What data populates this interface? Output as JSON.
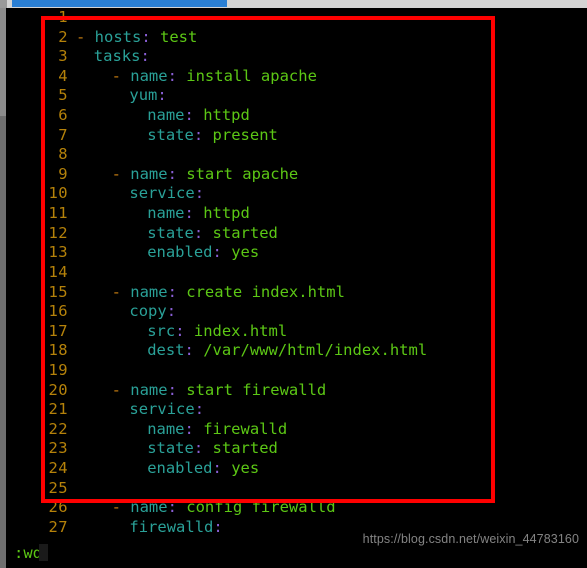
{
  "app": {
    "type": "terminal-text-editor",
    "editor": "vim",
    "language": "yaml"
  },
  "topbar": {
    "progress_visible": true,
    "progress_color": "#2a7fd4",
    "track_color": "#d4d4d4"
  },
  "colors": {
    "background": "#000000",
    "line_number": "#b5820a",
    "key": "#2aa198",
    "colon": "#8a5fd6",
    "value": "#5cc715",
    "dash": "#c07a10",
    "doc_start": "#9b6fd1",
    "annotation_box": "#ff0000",
    "status_text": "#5cc715"
  },
  "annotation": {
    "shape": "rectangle",
    "color": "#ff0000",
    "covers_lines": "1-24",
    "label": "red-highlight-box"
  },
  "editor": {
    "gutter_width": 62,
    "first_line": 1,
    "last_line": 27,
    "lines": [
      {
        "n": "1",
        "indent": 0,
        "tokens": [
          {
            "t": "doc",
            "s": "---"
          }
        ]
      },
      {
        "n": "2",
        "indent": 0,
        "tokens": [
          {
            "t": "dash",
            "s": "- "
          },
          {
            "t": "key",
            "s": "hosts"
          },
          {
            "t": "colon",
            "s": ": "
          },
          {
            "t": "val",
            "s": "test"
          }
        ]
      },
      {
        "n": "3",
        "indent": 1,
        "tokens": [
          {
            "t": "key",
            "s": "tasks"
          },
          {
            "t": "colon",
            "s": ":"
          }
        ]
      },
      {
        "n": "4",
        "indent": 2,
        "tokens": [
          {
            "t": "dash",
            "s": "- "
          },
          {
            "t": "key",
            "s": "name"
          },
          {
            "t": "colon",
            "s": ": "
          },
          {
            "t": "val",
            "s": "install apache"
          }
        ]
      },
      {
        "n": "5",
        "indent": 3,
        "tokens": [
          {
            "t": "key",
            "s": "yum"
          },
          {
            "t": "colon",
            "s": ":"
          }
        ]
      },
      {
        "n": "6",
        "indent": 4,
        "tokens": [
          {
            "t": "key",
            "s": "name"
          },
          {
            "t": "colon",
            "s": ": "
          },
          {
            "t": "val",
            "s": "httpd"
          }
        ]
      },
      {
        "n": "7",
        "indent": 4,
        "tokens": [
          {
            "t": "key",
            "s": "state"
          },
          {
            "t": "colon",
            "s": ": "
          },
          {
            "t": "val",
            "s": "present"
          }
        ]
      },
      {
        "n": "8",
        "indent": 0,
        "tokens": []
      },
      {
        "n": "9",
        "indent": 2,
        "tokens": [
          {
            "t": "dash",
            "s": "- "
          },
          {
            "t": "key",
            "s": "name"
          },
          {
            "t": "colon",
            "s": ": "
          },
          {
            "t": "val",
            "s": "start apache"
          }
        ]
      },
      {
        "n": "10",
        "indent": 3,
        "tokens": [
          {
            "t": "key",
            "s": "service"
          },
          {
            "t": "colon",
            "s": ":"
          }
        ]
      },
      {
        "n": "11",
        "indent": 4,
        "tokens": [
          {
            "t": "key",
            "s": "name"
          },
          {
            "t": "colon",
            "s": ": "
          },
          {
            "t": "val",
            "s": "httpd"
          }
        ]
      },
      {
        "n": "12",
        "indent": 4,
        "tokens": [
          {
            "t": "key",
            "s": "state"
          },
          {
            "t": "colon",
            "s": ": "
          },
          {
            "t": "val",
            "s": "started"
          }
        ]
      },
      {
        "n": "13",
        "indent": 4,
        "tokens": [
          {
            "t": "key",
            "s": "enabled"
          },
          {
            "t": "colon",
            "s": ": "
          },
          {
            "t": "val",
            "s": "yes"
          }
        ]
      },
      {
        "n": "14",
        "indent": 0,
        "tokens": []
      },
      {
        "n": "15",
        "indent": 2,
        "tokens": [
          {
            "t": "dash",
            "s": "- "
          },
          {
            "t": "key",
            "s": "name"
          },
          {
            "t": "colon",
            "s": ": "
          },
          {
            "t": "val",
            "s": "create index.html"
          }
        ]
      },
      {
        "n": "16",
        "indent": 3,
        "tokens": [
          {
            "t": "key",
            "s": "copy"
          },
          {
            "t": "colon",
            "s": ":"
          }
        ]
      },
      {
        "n": "17",
        "indent": 4,
        "tokens": [
          {
            "t": "key",
            "s": "src"
          },
          {
            "t": "colon",
            "s": ": "
          },
          {
            "t": "val",
            "s": "index.html"
          }
        ]
      },
      {
        "n": "18",
        "indent": 4,
        "tokens": [
          {
            "t": "key",
            "s": "dest"
          },
          {
            "t": "colon",
            "s": ": "
          },
          {
            "t": "val",
            "s": "/var/www/html/index.html"
          }
        ]
      },
      {
        "n": "19",
        "indent": 0,
        "tokens": []
      },
      {
        "n": "20",
        "indent": 2,
        "tokens": [
          {
            "t": "dash",
            "s": "- "
          },
          {
            "t": "key",
            "s": "name"
          },
          {
            "t": "colon",
            "s": ": "
          },
          {
            "t": "val",
            "s": "start firewalld"
          }
        ]
      },
      {
        "n": "21",
        "indent": 3,
        "tokens": [
          {
            "t": "key",
            "s": "service"
          },
          {
            "t": "colon",
            "s": ":"
          }
        ]
      },
      {
        "n": "22",
        "indent": 4,
        "tokens": [
          {
            "t": "key",
            "s": "name"
          },
          {
            "t": "colon",
            "s": ": "
          },
          {
            "t": "val",
            "s": "firewalld"
          }
        ]
      },
      {
        "n": "23",
        "indent": 4,
        "tokens": [
          {
            "t": "key",
            "s": "state"
          },
          {
            "t": "colon",
            "s": ": "
          },
          {
            "t": "val",
            "s": "started"
          }
        ]
      },
      {
        "n": "24",
        "indent": 4,
        "tokens": [
          {
            "t": "key",
            "s": "enabled"
          },
          {
            "t": "colon",
            "s": ": "
          },
          {
            "t": "val",
            "s": "yes"
          }
        ]
      },
      {
        "n": "25",
        "indent": 0,
        "tokens": []
      },
      {
        "n": "26",
        "indent": 2,
        "tokens": [
          {
            "t": "dash",
            "s": "- "
          },
          {
            "t": "key",
            "s": "name"
          },
          {
            "t": "colon",
            "s": ": "
          },
          {
            "t": "val",
            "s": "config firewalld"
          }
        ]
      },
      {
        "n": "27",
        "indent": 3,
        "tokens": [
          {
            "t": "key",
            "s": "firewalld"
          },
          {
            "t": "colon",
            "s": ":"
          }
        ]
      }
    ]
  },
  "statusbar": {
    "command": ":wq"
  },
  "watermark": {
    "text": "https://blog.csdn.net/weixin_44783160"
  }
}
